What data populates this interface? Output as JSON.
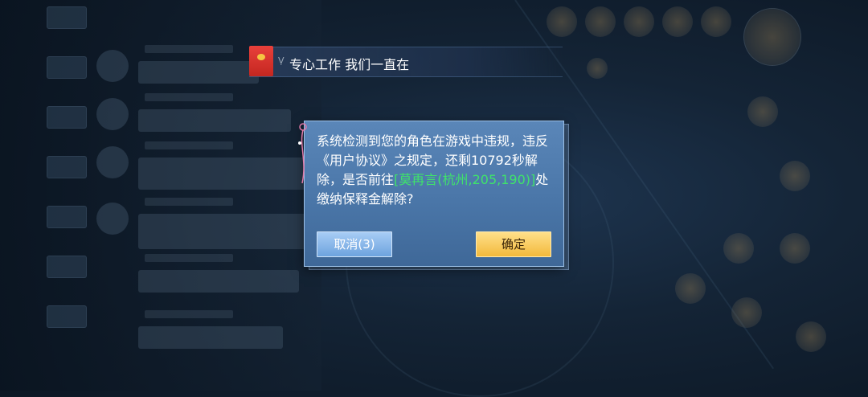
{
  "broadcast": {
    "icon": "red-envelope-icon",
    "prefix_glyph": "Ṿ",
    "text": "专心工作 我们一直在"
  },
  "dialog": {
    "message_part1": "系统检测到您的角色在游戏中违规，违反《用户协议》之规定，还剩10792秒解除，是否前往",
    "location_link": "[莫再言(杭州,205,190)]",
    "message_part2": "处缴纳保释金解除?",
    "cancel_label": "取消(3)",
    "confirm_label": "确定"
  },
  "colors": {
    "highlight": "#3fe46a",
    "confirm_button": "#f2b93c",
    "cancel_button": "#6da3de"
  }
}
